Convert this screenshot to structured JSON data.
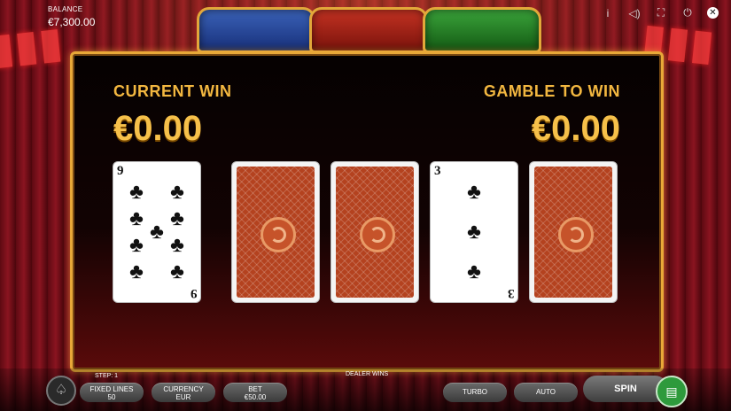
{
  "header": {
    "balance_label": "BALANCE",
    "balance_value": "€7,300.00",
    "icons": [
      "info-icon",
      "sound-icon",
      "fullscreen-icon",
      "power-icon",
      "close-icon"
    ]
  },
  "panel": {
    "current_win_label": "CURRENT WIN",
    "current_win_value": "€0.00",
    "gamble_label": "GAMBLE TO WIN",
    "gamble_value": "€0.00",
    "cards": [
      {
        "face": "up",
        "rank": "9",
        "suit": "♣"
      },
      {
        "face": "down"
      },
      {
        "face": "down"
      },
      {
        "face": "up",
        "rank": "3",
        "suit": "♣"
      },
      {
        "face": "down"
      }
    ]
  },
  "footer": {
    "step": "STEP: 1",
    "dealer_status": "DEALER WINS",
    "fixed_lines_label": "FIXED LINES",
    "fixed_lines_value": "50",
    "currency_label": "CURRENCY",
    "currency_value": "EUR",
    "bet_label": "BET",
    "bet_value": "€50.00",
    "turbo": "TURBO",
    "auto": "AUTO",
    "spin": "SPIN"
  },
  "colors": {
    "accent_gold": "#f2b740",
    "card_back": "#b4421f",
    "spin_green": "#2e9a3c"
  }
}
